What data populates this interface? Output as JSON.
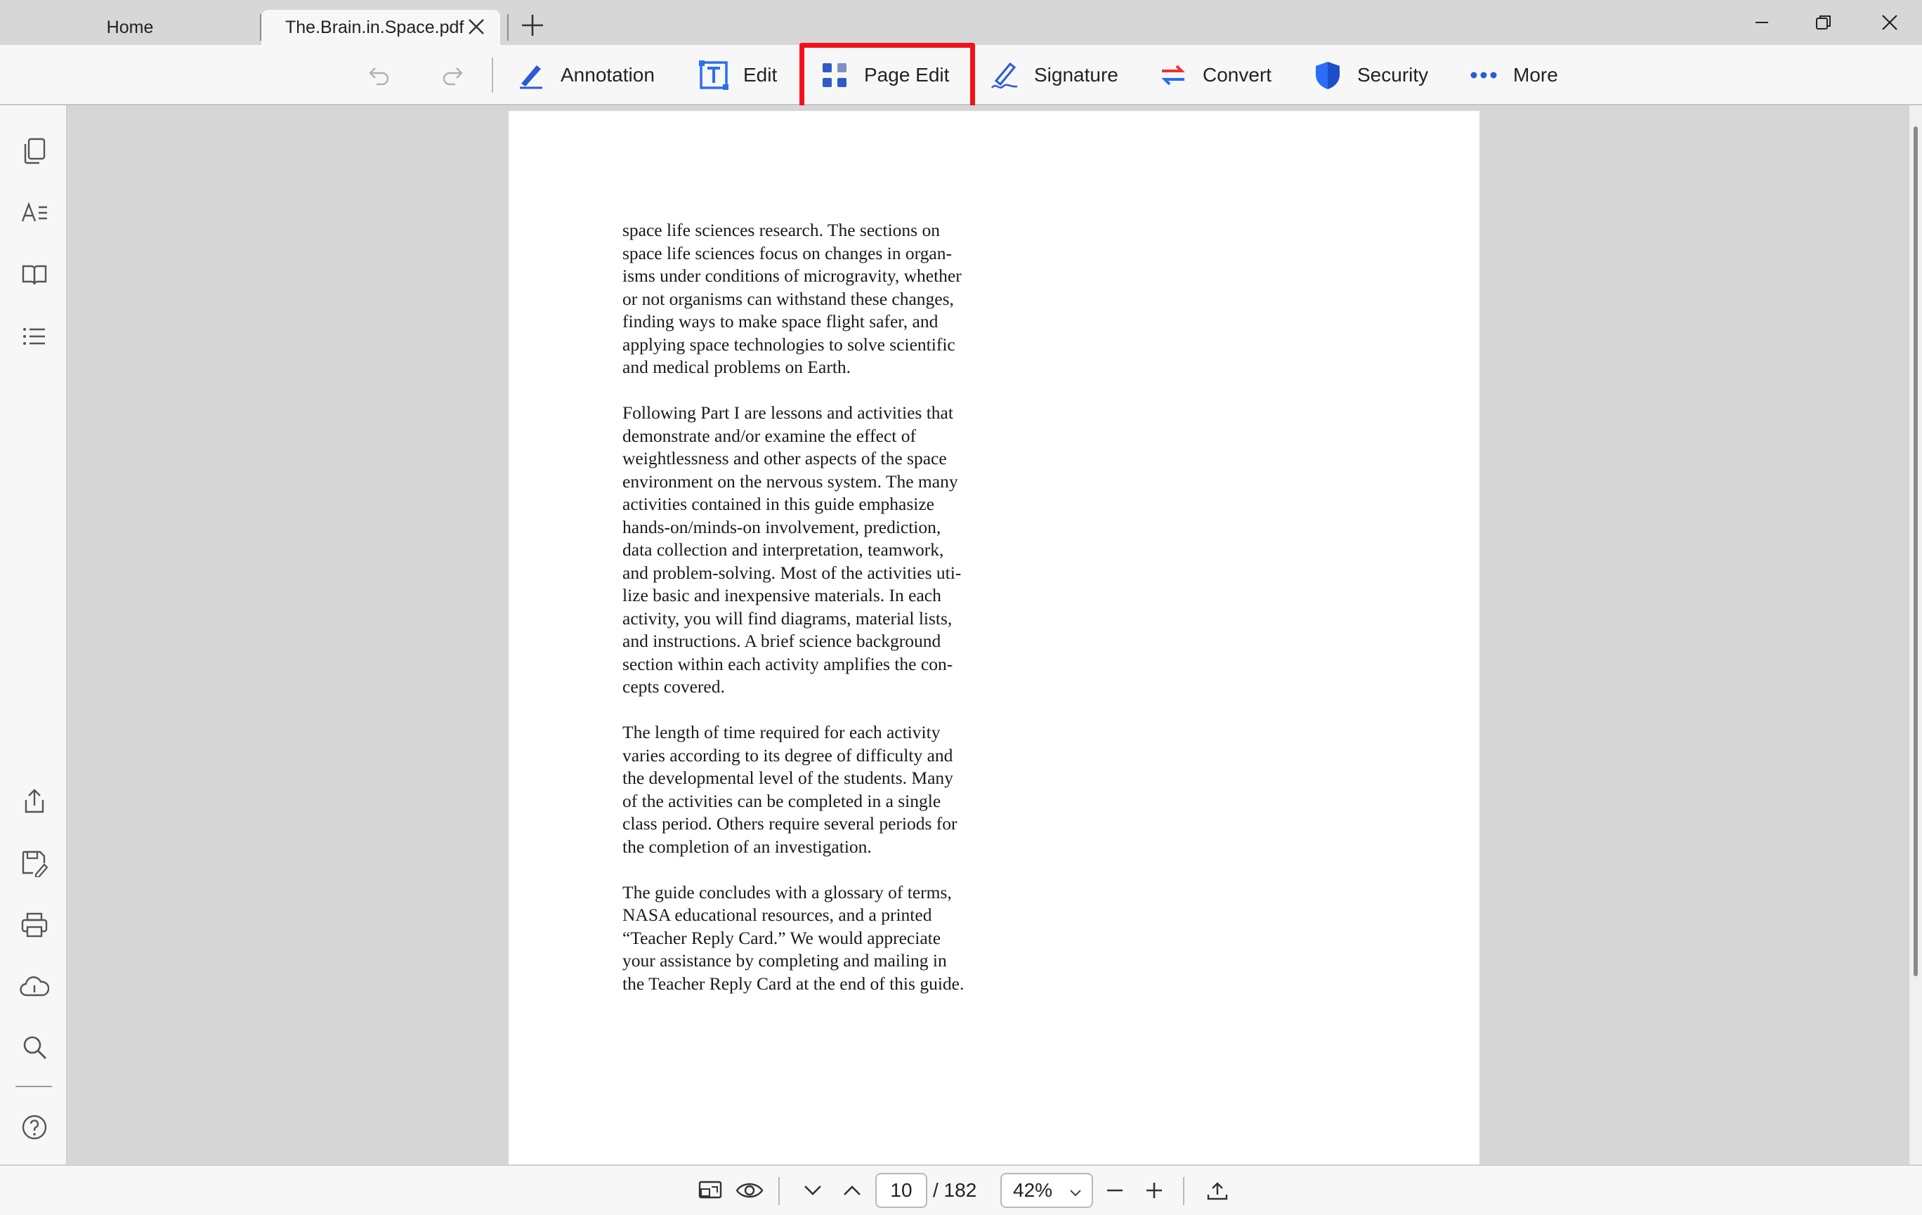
{
  "tabs": {
    "home_label": "Home",
    "document_label": "The.Brain.in.Space.pdf"
  },
  "toolbar": {
    "items": [
      {
        "label": "Annotation",
        "icon": "pen-icon"
      },
      {
        "label": "Edit",
        "icon": "text-edit-icon"
      },
      {
        "label": "Page Edit",
        "icon": "grid-icon"
      },
      {
        "label": "Signature",
        "icon": "signature-icon"
      },
      {
        "label": "Convert",
        "icon": "convert-icon"
      },
      {
        "label": "Security",
        "icon": "shield-icon"
      },
      {
        "label": "More",
        "icon": "more-dots-icon"
      }
    ],
    "highlighted_item": "Page Edit",
    "highlight_color": "#f2121b"
  },
  "document": {
    "paragraphs": [
      [
        "space life sciences research.  The sections on",
        "space life sciences focus on changes in organ-",
        "isms under conditions of microgravity, whether",
        "or not organisms can withstand these changes,",
        "finding ways to make space flight safer, and",
        "applying space technologies to solve scientific",
        "and medical problems on Earth."
      ],
      [
        "Following Part I are lessons and activities that",
        "demonstrate and/or examine the effect of",
        "weightlessness and other aspects of the space",
        "environment on the nervous system.  The many",
        "activities contained in this guide emphasize",
        "hands-on/minds-on involvement, prediction,",
        "data collection and interpretation, teamwork,",
        "and problem-solving. Most of the activities uti-",
        "lize basic and inexpensive materials. In each",
        "activity, you will find diagrams, material lists,",
        "and instructions.  A brief science background",
        "section within each activity amplifies the con-",
        "cepts covered."
      ],
      [
        "The length of time required for each activity",
        "varies according to its degree of difficulty and",
        "the developmental level of the students.  Many",
        "of the activities can be completed in a single",
        "class period.  Others require several periods for",
        "the completion of an investigation."
      ],
      [
        "The guide concludes with a glossary of terms,",
        "NASA educational resources, and a printed",
        "“Teacher Reply Card.”  We would appreciate",
        "your assistance by completing and mailing in",
        "the Teacher Reply Card at the end of this guide."
      ]
    ]
  },
  "navigation": {
    "current_page": "10",
    "total_pages": "/ 182",
    "zoom": "42%"
  }
}
